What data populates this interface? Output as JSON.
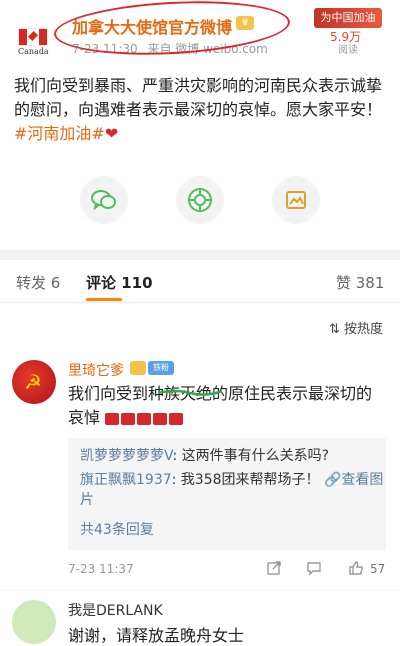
{
  "post": {
    "author": "加拿大大使馆官方微博",
    "avatar_caption": "Canada",
    "time": "7-23 11:30",
    "source": "来自 微博 weibo.com",
    "text_main": "我们向受到暴雨、严重洪灾影响的河南民众表示诚挚的慰问，向遇难者表示最深切的哀悼。愿大家平安！",
    "topic": "#河南加油#",
    "heart": "❤",
    "promo_tag": "为中国加油",
    "promo_count": "5.9万",
    "promo_read": "阅读"
  },
  "share": {
    "wechat_icon": "wechat-icon",
    "moments_icon": "moments-icon",
    "save_icon": "save-image-icon"
  },
  "tabs": [
    {
      "label": "转发 6"
    },
    {
      "label": "评论 110"
    },
    {
      "label": "赞 381"
    }
  ],
  "sort_label": "按热度",
  "comment": {
    "name": "里琦它爹",
    "text": "我们向受到种族灭绝的原住民表示最深切的哀悼",
    "replies": [
      {
        "name": "凯萝萝萝萝萝V",
        "text": ": 这两件事有什么关系吗?"
      },
      {
        "name": "旗正飘飘1937",
        "text": ": 我358团来帮帮场子！",
        "view_pic": "查看图片"
      }
    ],
    "reply_total": "共43条回复",
    "time": "7-23 11:37",
    "likes": "57"
  },
  "comment2": {
    "name": "我是DERLANK",
    "text": "谢谢，请释放孟晚舟女士"
  },
  "colors": {
    "accent": "#ff8200",
    "name_orange": "#e86a10",
    "annotation_red": "#e0262a",
    "link_blue": "#5b7ea6"
  }
}
